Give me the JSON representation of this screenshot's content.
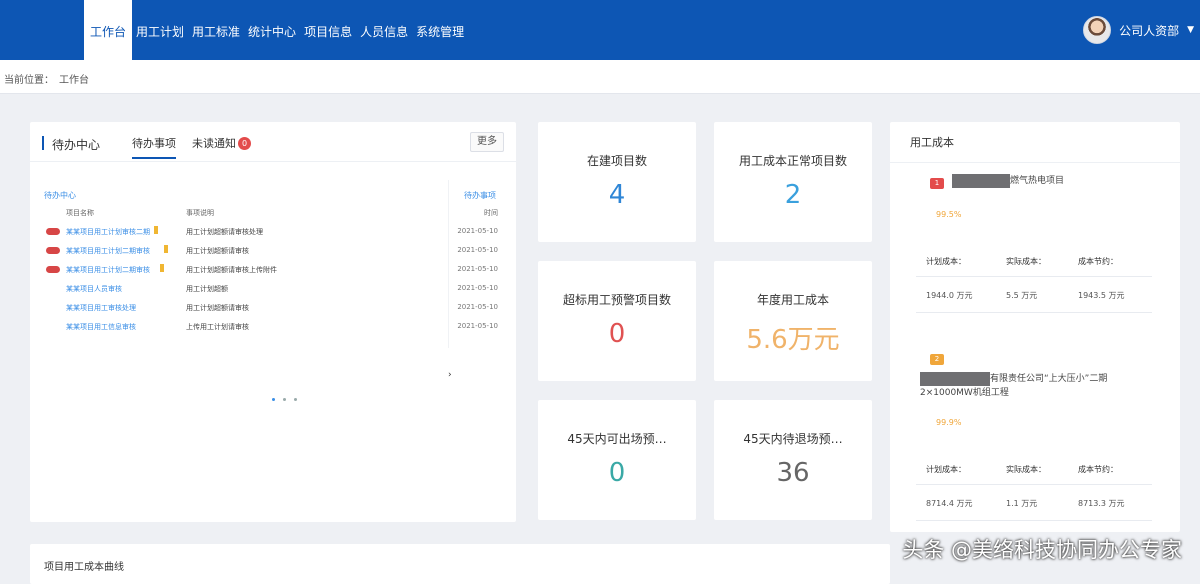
{
  "nav": {
    "items": [
      "工作台",
      "用工计划",
      "用工标准",
      "统计中心",
      "项目信息",
      "人员信息",
      "系统管理"
    ],
    "user": "公司人资部"
  },
  "breadcrumb": {
    "label": "当前位置：",
    "current": "工作台"
  },
  "todo": {
    "title": "待办中心",
    "tabs": [
      "待办事项",
      "未读通知"
    ],
    "unread_count": "0",
    "more": "更多",
    "panel": {
      "left_label": "待办中心",
      "right_label": "待办事项",
      "col_headers": [
        "项目名称",
        "事项说明",
        "时间"
      ],
      "rows": [
        {
          "link": "某某项目用工计划审核二期",
          "desc": "用工计划超额请审核处理",
          "date": "2021-05-10"
        },
        {
          "link": "某某项目用工计划二期审核",
          "desc": "用工计划超额请审核",
          "date": "2021-05-10"
        },
        {
          "link": "某某项目用工计划二期审核",
          "desc": "用工计划超额请审核上传附件",
          "date": "2021-05-10"
        },
        {
          "link": "某某项目人员审核",
          "desc": "用工计划超额",
          "date": "2021-05-10"
        },
        {
          "link": "某某项目用工审核处理",
          "desc": "用工计划超额请审核",
          "date": "2021-05-10"
        },
        {
          "link": "某某项目用工信息审核",
          "desc": "上传用工计划请审核",
          "date": "2021-05-10"
        }
      ]
    }
  },
  "stats": [
    {
      "label": "在建项目数",
      "value": "4",
      "color": "#2f86d6"
    },
    {
      "label": "用工成本正常项目数",
      "value": "2",
      "color": "#3aa0dd"
    },
    {
      "label": "超标用工预警项目数",
      "value": "0",
      "color": "#e05252"
    },
    {
      "label": "年度用工成本",
      "value": "5.6万元",
      "color": "#f0b36a"
    },
    {
      "label": "45天内可出场预…",
      "value": "0",
      "color": "#3aa9a6"
    },
    {
      "label": "45天内待退场预…",
      "value": "36",
      "color": "#666666"
    }
  ],
  "cost": {
    "title": "用工成本",
    "projects": [
      {
        "badge": "1",
        "name": "燃气热电项目",
        "pct": "99.5%",
        "headers": [
          "计划成本：",
          "实际成本：",
          "成本节约："
        ],
        "values": [
          "1944.0 万元",
          "5.5 万元",
          "1943.5 万元"
        ]
      },
      {
        "badge": "2",
        "name": "有限责任公司“上大压小”二期2×1000MW机组工程",
        "pct": "99.9%",
        "headers": [
          "计划成本：",
          "实际成本：",
          "成本节约："
        ],
        "values": [
          "8714.4 万元",
          "1.1 万元",
          "8713.3 万元"
        ]
      }
    ]
  },
  "bottom": {
    "title": "项目用工成本曲线"
  },
  "watermark": "头条 @美络科技协同办公专家"
}
